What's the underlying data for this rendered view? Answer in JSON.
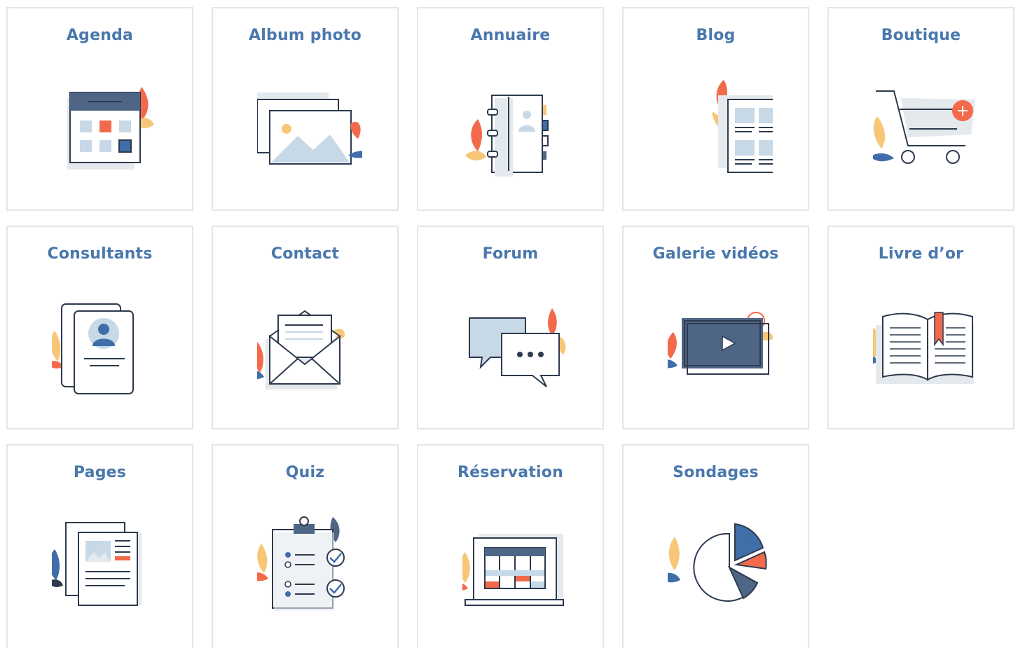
{
  "colors": {
    "title": "#4a78ad",
    "border": "#e3e5e8",
    "navy": "#2d3a4f",
    "slate": "#4f6585",
    "blue": "#3f6ea8",
    "light_blue": "#c7d8e6",
    "pale": "#e4e9ee",
    "orange": "#f26a4b",
    "yellow": "#f7c777"
  },
  "modules": [
    {
      "label": "Agenda",
      "icon": "calendar-icon"
    },
    {
      "label": "Album photo",
      "icon": "photo-album-icon"
    },
    {
      "label": "Annuaire",
      "icon": "directory-book-icon"
    },
    {
      "label": "Blog",
      "icon": "blog-article-icon"
    },
    {
      "label": "Boutique",
      "icon": "shopping-cart-icon"
    },
    {
      "label": "Consultants",
      "icon": "profile-card-icon"
    },
    {
      "label": "Contact",
      "icon": "envelope-icon"
    },
    {
      "label": "Forum",
      "icon": "chat-bubbles-icon"
    },
    {
      "label": "Galerie vidéos",
      "icon": "video-player-icon"
    },
    {
      "label": "Livre d’or",
      "icon": "open-book-icon"
    },
    {
      "label": "Pages",
      "icon": "pages-icon"
    },
    {
      "label": "Quiz",
      "icon": "clipboard-checklist-icon"
    },
    {
      "label": "Réservation",
      "icon": "booking-laptop-icon"
    },
    {
      "label": "Sondages",
      "icon": "pie-chart-icon"
    }
  ]
}
